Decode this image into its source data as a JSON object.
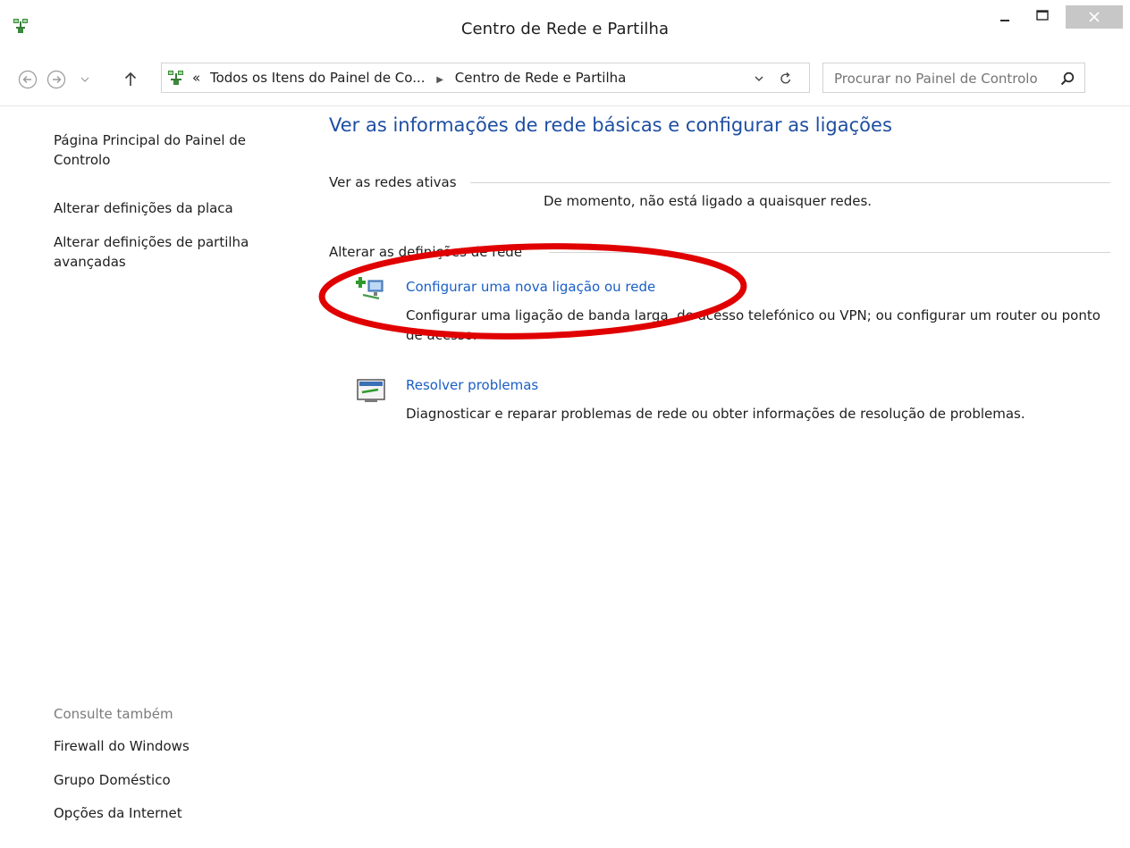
{
  "window": {
    "title": "Centro de Rede e Partilha"
  },
  "navbar": {
    "breadcrumb_sep": "«",
    "breadcrumb": [
      "Todos os Itens do Painel de Co...",
      "Centro de Rede e Partilha"
    ],
    "search_placeholder": "Procurar no Painel de Controlo"
  },
  "sidebar": {
    "home_link": "Página Principal do Painel de Controlo",
    "links": [
      "Alterar definições da placa",
      "Alterar definições de partilha avançadas"
    ],
    "see_also_title": "Consulte também",
    "see_also": [
      "Firewall do Windows",
      "Grupo Doméstico",
      "Opções da Internet"
    ]
  },
  "main": {
    "title": "Ver as informações de rede básicas e configurar as ligações",
    "active_networks_header": "Ver as redes ativas",
    "no_network_text": "De momento, não está ligado a quaisquer redes.",
    "change_settings_header": "Alterar as definições de rede",
    "tasks": [
      {
        "icon": "network-add-icon",
        "label": "Configurar uma nova ligação ou rede",
        "description": "Configurar uma ligação de banda larga, de acesso telefónico ou VPN; ou configurar um router ou ponto de acesso."
      },
      {
        "icon": "troubleshoot-icon",
        "label": "Resolver problemas",
        "description": "Diagnosticar e reparar problemas de rede ou obter informações de resolução de problemas."
      }
    ]
  },
  "colors": {
    "title_blue": "#1e4ea2",
    "link_blue": "#1a5ec6",
    "annotation_red": "#e00000",
    "close_button": "#c7c7c7"
  }
}
